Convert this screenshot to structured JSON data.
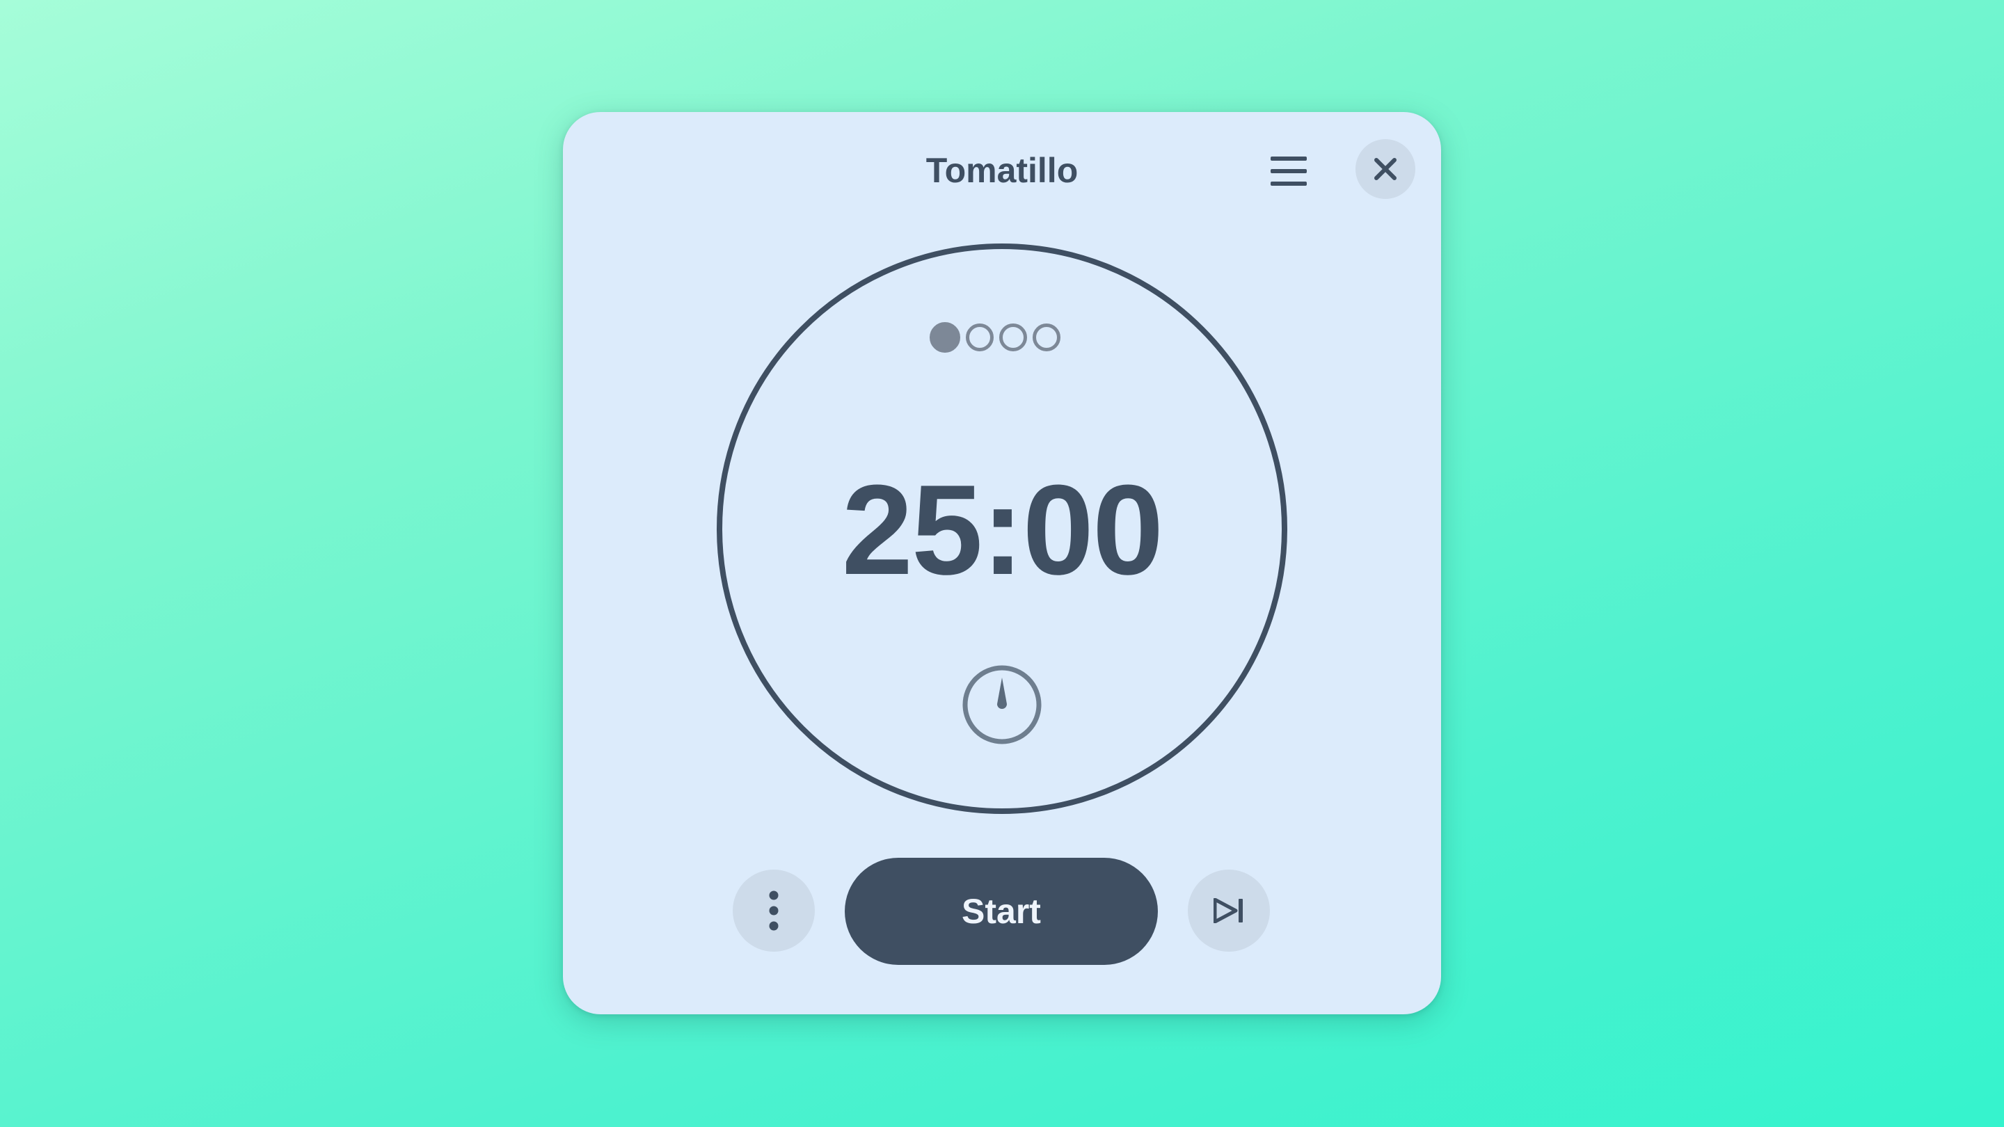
{
  "app": {
    "title": "Tomatillo"
  },
  "header": {
    "menu_icon": "hamburger-menu-icon",
    "close_icon": "close-icon"
  },
  "timer": {
    "time": "25:00",
    "sessions_total": 4,
    "sessions_completed": 1,
    "mode_icon": "gauge-icon"
  },
  "controls": {
    "more_icon": "more-vertical-icon",
    "start_label": "Start",
    "skip_icon": "skip-next-icon"
  },
  "colors": {
    "background_start": "#a6fdd9",
    "background_end": "#35f3cd",
    "window": "#dcebfb",
    "primary": "#3f4f62",
    "muted": "#7d8897",
    "button_bg": "#cddbea"
  }
}
